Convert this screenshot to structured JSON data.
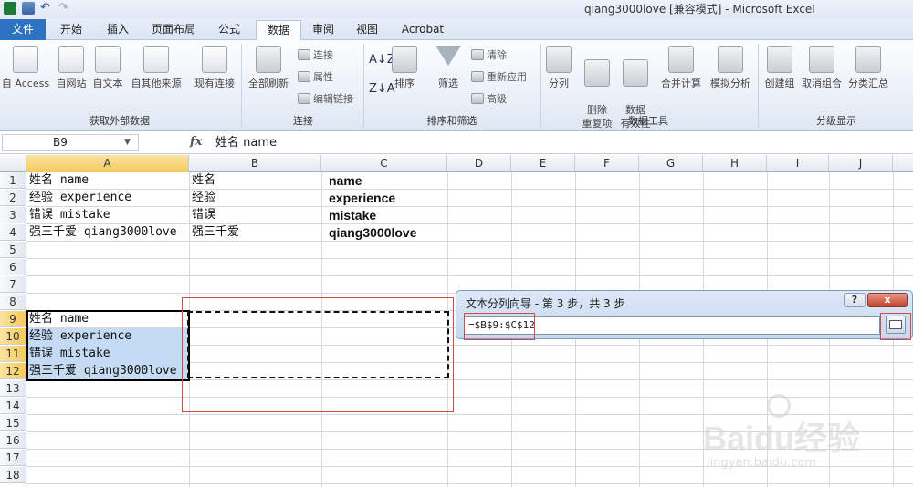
{
  "window": {
    "title": "qiang3000love  [兼容模式]  -  Microsoft Excel"
  },
  "tabs": [
    "文件",
    "开始",
    "插入",
    "页面布局",
    "公式",
    "数据",
    "审阅",
    "视图",
    "Acrobat"
  ],
  "ribbon": {
    "get_external": {
      "buttons": [
        "自 Access",
        "自网站",
        "自文本",
        "自其他来源",
        "现有连接"
      ],
      "label": "获取外部数据"
    },
    "connections": {
      "refresh": "全部刷新",
      "small": [
        "连接",
        "属性",
        "编辑链接"
      ],
      "label": "连接"
    },
    "sort_filter": {
      "sort": "排序",
      "filter": "筛选",
      "small": [
        "清除",
        "重新应用",
        "高级"
      ],
      "label": "排序和筛选"
    },
    "data_tools": {
      "buttons": [
        "分列",
        "删除\n重复项",
        "数据\n有效性",
        "合并计算",
        "模拟分析"
      ],
      "label": "数据工具"
    },
    "outline": {
      "buttons": [
        "创建组",
        "取消组合",
        "分类汇总"
      ],
      "label": "分级显示"
    }
  },
  "formula_bar": {
    "name_box": "B9",
    "fx": "fx",
    "formula": "姓名 name"
  },
  "columns": [
    "A",
    "B",
    "C",
    "D",
    "E",
    "F",
    "G",
    "H",
    "I",
    "J"
  ],
  "rows": [
    "1",
    "2",
    "3",
    "4",
    "5",
    "6",
    "7",
    "8",
    "9",
    "10",
    "11",
    "12",
    "13",
    "14",
    "15",
    "16",
    "17",
    "18"
  ],
  "cells": {
    "A1": "姓名 name",
    "B1": "姓名",
    "C1": "name",
    "A2": "经验 experience",
    "B2": "经验",
    "C2": "experience",
    "A3": "错误 mistake",
    "B3": "错误",
    "C3": "mistake",
    "A4": "强三千爱 qiang3000love",
    "B4": "强三千爱",
    "C4": "qiang3000love",
    "A9": "姓名 name",
    "A10": "经验 experience",
    "A11": "错误 mistake",
    "A12": "强三千爱 qiang3000love"
  },
  "dialog": {
    "title": "文本分列向导 - 第 3 步，共 3 步",
    "help": "?",
    "close": "x",
    "range_value": "=$B$9:$C$12"
  },
  "watermark": {
    "brand": "Baidu经验",
    "url": "jingyan.baidu.com"
  }
}
